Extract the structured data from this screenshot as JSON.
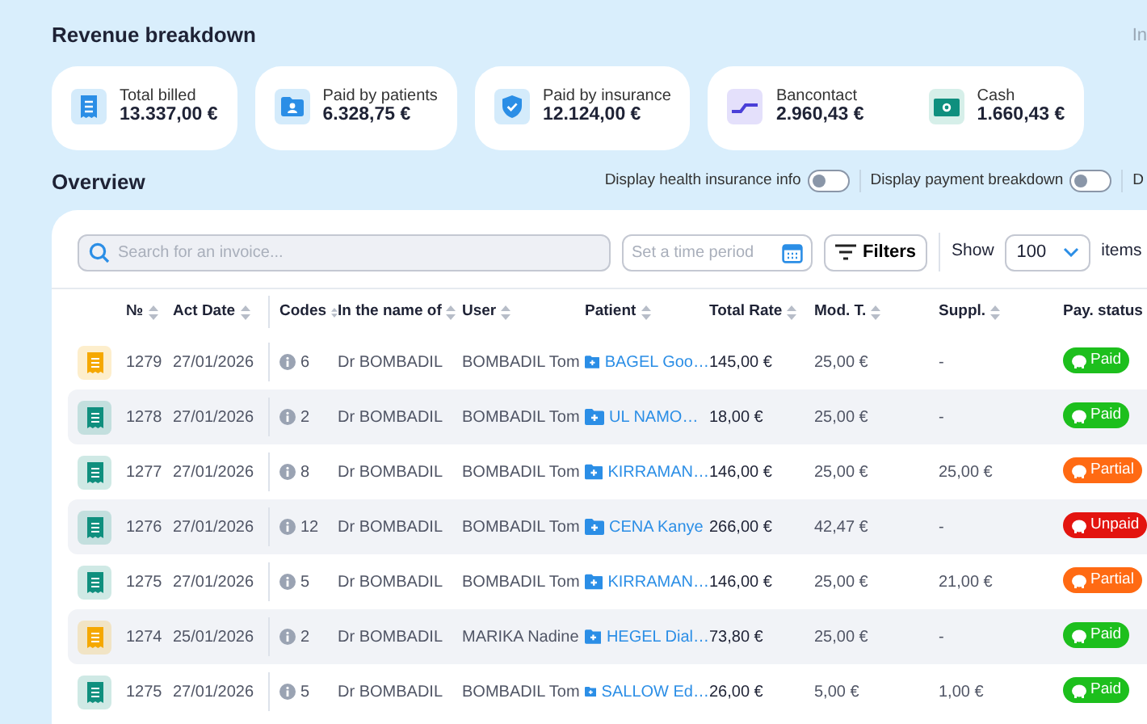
{
  "section_title": "Revenue breakdown",
  "corner_text": "In",
  "summary_cards": [
    {
      "items": [
        {
          "kind": "receipt",
          "label": "Total billed",
          "amount": "13.337,00 €"
        }
      ]
    },
    {
      "items": [
        {
          "kind": "patient",
          "label": "Paid by patients",
          "amount": "6.328,75 €"
        }
      ]
    },
    {
      "items": [
        {
          "kind": "insurance",
          "label": "Paid by insurance",
          "amount": "12.124,00 €"
        }
      ]
    },
    {
      "items": [
        {
          "kind": "bancontact",
          "label": "Bancontact",
          "amount": "2.960,43 €"
        },
        {
          "kind": "cash",
          "label": "Cash",
          "amount": "1.660,43 €"
        }
      ]
    }
  ],
  "overview": {
    "title": "Overview",
    "toggles": [
      {
        "label": "Display health insurance info",
        "on": false
      },
      {
        "label": "Display payment breakdown",
        "on": false
      }
    ],
    "cut_text": "D"
  },
  "toolbar": {
    "search": {
      "placeholder": "Search for an invoice..."
    },
    "period": {
      "placeholder": "Set a time period"
    },
    "filters_button": "Filters",
    "page_size": {
      "label": "Show",
      "value": "100",
      "suffix": "items"
    }
  },
  "table": {
    "columns": [
      "№",
      "Act Date",
      "Codes",
      "In the name of",
      "User",
      "Patient",
      "Total Rate",
      "Mod. T.",
      "Suppl.",
      "Pay. status"
    ],
    "rows": [
      {
        "color": "#f5a800",
        "number": "1279",
        "act_date": "27/01/2026",
        "codes": "6",
        "name": "Dr BOMBADIL",
        "user": "BOMBADIL Tom",
        "patient": "BAGEL Goo…",
        "total_rate": "145,00 €",
        "mod_t": "25,00 €",
        "suppl": "-",
        "status": {
          "kind": "paid",
          "label": "Paid"
        }
      },
      {
        "color": "#0f8f7e",
        "number": "1278",
        "act_date": "27/01/2026",
        "codes": "2",
        "name": "Dr BOMBADIL",
        "user": "BOMBADIL Tom",
        "patient": "UL NAMO…",
        "total_rate": "18,00 €",
        "mod_t": "25,00 €",
        "suppl": "-",
        "status": {
          "kind": "paid",
          "label": "Paid"
        }
      },
      {
        "color": "#0f8f7e",
        "number": "1277",
        "act_date": "27/01/2026",
        "codes": "8",
        "name": "Dr BOMBADIL",
        "user": "BOMBADIL Tom",
        "patient": "KIRRAMAN…",
        "total_rate": "146,00 €",
        "mod_t": "25,00 €",
        "suppl": "25,00 €",
        "status": {
          "kind": "partial",
          "label": "Partial"
        }
      },
      {
        "color": "#0f8f7e",
        "number": "1276",
        "act_date": "27/01/2026",
        "codes": "12",
        "name": "Dr BOMBADIL",
        "user": "BOMBADIL Tom",
        "patient": "CENA Kanye",
        "total_rate": "266,00 €",
        "mod_t": "42,47 €",
        "suppl": "-",
        "status": {
          "kind": "unpaid",
          "label": "Unpaid"
        }
      },
      {
        "color": "#0f8f7e",
        "number": "1275",
        "act_date": "27/01/2026",
        "codes": "5",
        "name": "Dr BOMBADIL",
        "user": "BOMBADIL Tom",
        "patient": "KIRRAMAN…",
        "total_rate": "146,00 €",
        "mod_t": "25,00 €",
        "suppl": "21,00 €",
        "status": {
          "kind": "partial",
          "label": "Partial"
        }
      },
      {
        "color": "#f5a800",
        "number": "1274",
        "act_date": "25/01/2026",
        "codes": "2",
        "name": "Dr BOMBADIL",
        "user": "MARIKA Nadine",
        "patient": "HEGEL Dial…",
        "total_rate": "73,80 €",
        "mod_t": "25,00 €",
        "suppl": "-",
        "status": {
          "kind": "paid",
          "label": "Paid"
        }
      },
      {
        "color": "#0f8f7e",
        "number": "1275",
        "act_date": "27/01/2026",
        "codes": "5",
        "name": "Dr BOMBADIL",
        "user": "BOMBADIL Tom",
        "patient": "SALLOW Ed…",
        "total_rate": "26,00 €",
        "mod_t": "5,00 €",
        "suppl": "1,00 €",
        "status": {
          "kind": "paid",
          "label": "Paid"
        }
      }
    ]
  }
}
